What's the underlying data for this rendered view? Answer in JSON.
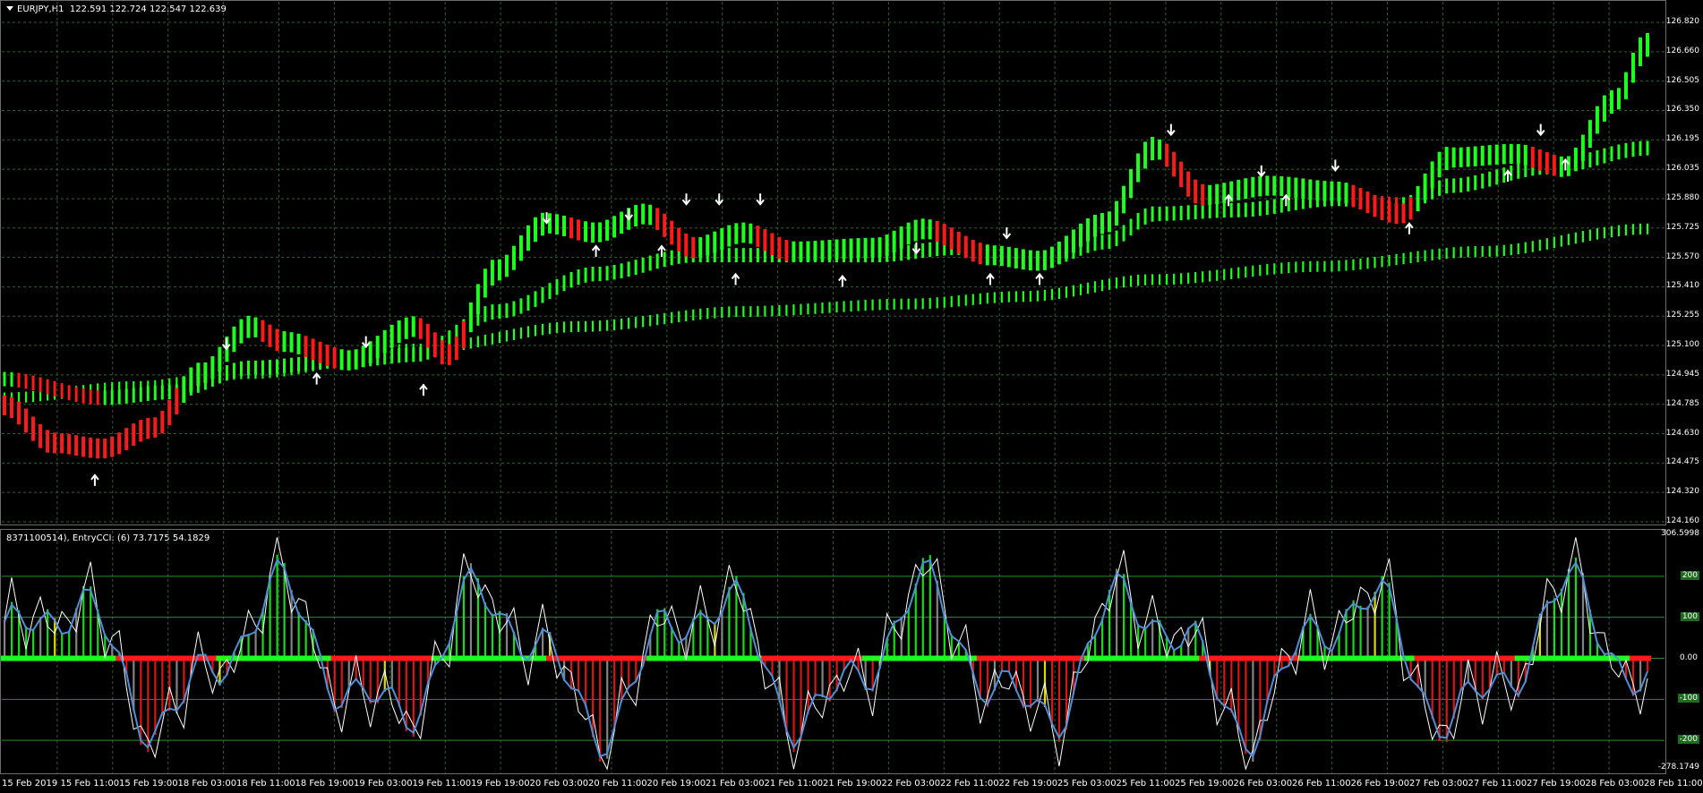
{
  "main": {
    "symbol_label": "EURJPY,H1",
    "ohlc": "122.591 122.724 122.547 122.639",
    "y_ticks": [
      "126.820",
      "126.660",
      "126.505",
      "126.350",
      "126.195",
      "126.035",
      "125.880",
      "125.725",
      "125.570",
      "125.410",
      "125.255",
      "125.100",
      "124.945",
      "124.785",
      "124.630",
      "124.475",
      "124.320",
      "124.160"
    ]
  },
  "sub": {
    "label": "8371100514), EntryCCI: (6) 73.7175 54.1829",
    "top_value": "306.5998",
    "bottom_value": "-278.1749",
    "level_ticks": [
      "200",
      "100",
      "0.00",
      "-100",
      "-200"
    ]
  },
  "x_ticks": [
    "15 Feb 2019",
    "15 Feb 11:00",
    "15 Feb 19:00",
    "18 Feb 03:00",
    "18 Feb 11:00",
    "18 Feb 19:00",
    "19 Feb 03:00",
    "19 Feb 11:00",
    "19 Feb 19:00",
    "20 Feb 03:00",
    "20 Feb 11:00",
    "20 Feb 19:00",
    "21 Feb 03:00",
    "21 Feb 11:00",
    "21 Feb 19:00",
    "22 Feb 03:00",
    "22 Feb 11:00",
    "22 Feb 19:00",
    "25 Feb 03:00",
    "25 Feb 11:00",
    "25 Feb 19:00",
    "26 Feb 03:00",
    "26 Feb 11:00",
    "26 Feb 19:00",
    "27 Feb 03:00",
    "27 Feb 11:00",
    "27 Feb 19:00",
    "28 Feb 03:00",
    "28 Feb 11:00"
  ],
  "colors": {
    "bull": "#1dff1d",
    "bear": "#ff1a1a",
    "grid": "#2f5f2f",
    "arrow": "#ffffff",
    "cci_line": "#4f8fd6",
    "cci_fast": "#ffffff",
    "yellow_bar": "#ffff00",
    "gray_bar": "#9a9a9a",
    "level_line": "#2e8b2e"
  }
}
